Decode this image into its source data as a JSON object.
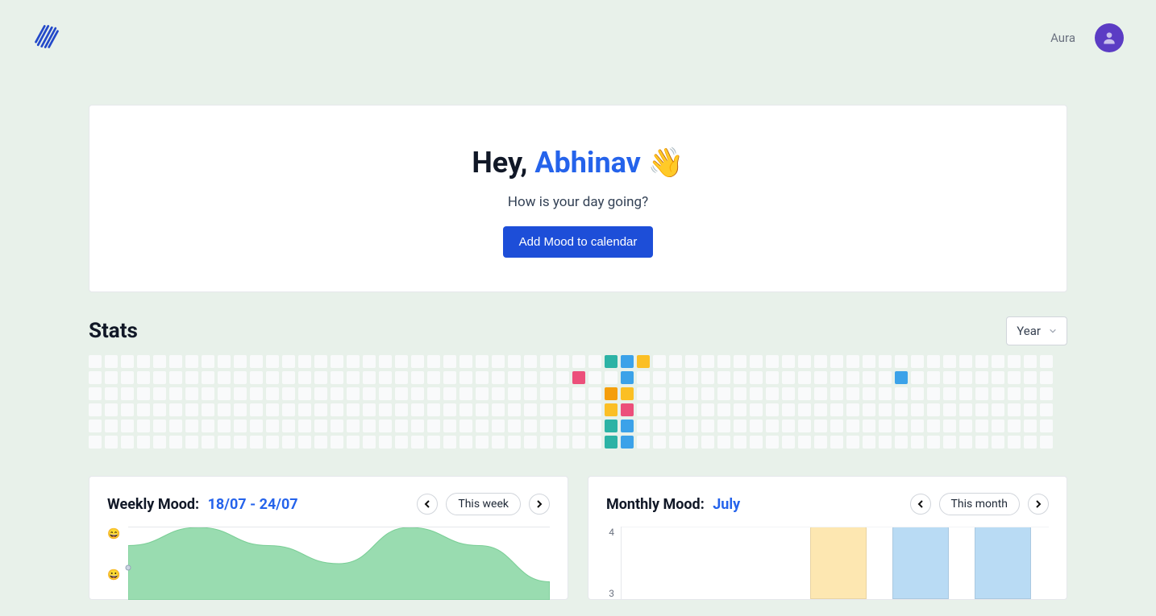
{
  "header": {
    "username": "Aura"
  },
  "hero": {
    "greeting_prefix": "Hey, ",
    "name": "Abhinav",
    "wave_emoji": "👋",
    "subtitle": "How is your day going?",
    "cta_label": "Add Mood to calendar"
  },
  "stats": {
    "heading": "Stats",
    "range_selector": "Year",
    "heatmap": {
      "rows": 6,
      "columns": 60,
      "cells": {
        "30-1": "pink",
        "32-0": "teal",
        "32-2": "orange",
        "32-3": "yellow",
        "32-4": "teal",
        "32-5": "teal",
        "33-0": "blue",
        "33-1": "blue",
        "33-2": "yellow",
        "33-3": "pink",
        "33-4": "blue",
        "33-5": "blue",
        "34-0": "yellow",
        "50-1": "blue"
      }
    }
  },
  "weekly": {
    "title": "Weekly Mood:",
    "range": "18/07 - 24/07",
    "period_label": "This week",
    "emojis": [
      "😄",
      "😀"
    ]
  },
  "monthly": {
    "title": "Monthly Mood:",
    "range": "July",
    "period_label": "This month"
  },
  "chart_data": [
    {
      "type": "area",
      "name": "Weekly Mood",
      "x": [
        0,
        1,
        2,
        3,
        4,
        5,
        6
      ],
      "values": [
        4,
        5,
        4,
        3,
        5,
        4,
        2
      ],
      "ylim": [
        1,
        5
      ],
      "xlabel": "",
      "ylabel": ""
    },
    {
      "type": "bar",
      "name": "Monthly Mood",
      "categories": [
        "",
        "",
        "",
        "",
        ""
      ],
      "series": [
        {
          "name": "mood",
          "values": [
            null,
            null,
            4,
            4,
            4
          ],
          "colors": [
            "",
            "",
            "yellow",
            "blue",
            "blue"
          ]
        }
      ],
      "ylim": [
        3,
        4
      ],
      "y_ticks": [
        4,
        3
      ],
      "xlabel": "",
      "ylabel": ""
    }
  ]
}
